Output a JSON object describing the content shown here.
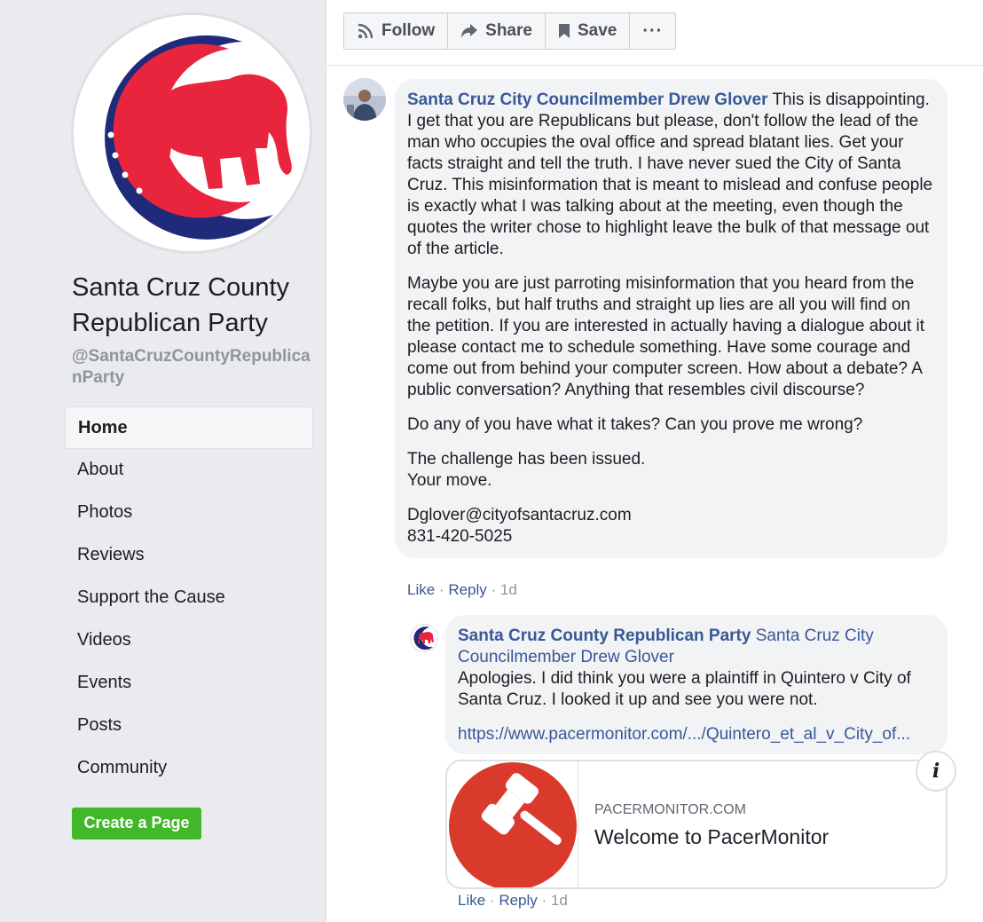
{
  "page": {
    "name": "Santa Cruz County Republican Party",
    "handle": "@SantaCruzCountyRepublicanParty"
  },
  "nav": {
    "items": [
      {
        "label": "Home",
        "active": true
      },
      {
        "label": "About"
      },
      {
        "label": "Photos"
      },
      {
        "label": "Reviews"
      },
      {
        "label": "Support the Cause"
      },
      {
        "label": "Videos"
      },
      {
        "label": "Events"
      },
      {
        "label": "Posts"
      },
      {
        "label": "Community"
      }
    ]
  },
  "create_page_label": "Create a Page",
  "actions": {
    "follow": "Follow",
    "share": "Share",
    "save": "Save",
    "more": "···"
  },
  "comment1": {
    "author": "Santa Cruz City Councilmember Drew Glover",
    "p1": "This is disappointing. I get that you are Republicans but please, don't follow the lead of the man who occupies the oval office and spread blatant lies. Get your facts straight and tell the truth. I have never sued the City of Santa Cruz. This misinformation that is meant to mislead and confuse people is exactly what I was talking about at the meeting, even though the quotes the writer chose to highlight leave the bulk of that message out of the article.",
    "p2": "Maybe you are just parroting misinformation that you heard from the recall folks, but half truths and straight up lies are all you will find on the petition. If you are interested in actually having a dialogue about it please contact me to schedule something. Have some courage and come out from behind your computer screen. How about a debate? A public conversation? Anything that resembles civil discourse?",
    "p3": "Do any of you have what it takes? Can you prove me wrong?",
    "p4a": "The challenge has been issued.",
    "p4b": "Your move.",
    "email": "Dglover@cityofsantacruz.com",
    "phone": "831-420-5025",
    "like": "Like",
    "reply": "Reply",
    "time": "1d"
  },
  "comment2": {
    "author": "Santa Cruz County Republican Party",
    "mention": "Santa Cruz City Councilmember Drew Glover",
    "text": "Apologies. I did think you were a plaintiff in Quintero v City of Santa Cruz. I looked it up and see you were not.",
    "url": "https://www.pacermonitor.com/.../Quintero_et_al_v_City_of...",
    "like": "Like",
    "reply": "Reply",
    "time": "1d"
  },
  "link_card": {
    "domain": "PACERMONITOR.COM",
    "title": "Welcome to PacerMonitor",
    "info_icon": "i"
  },
  "colors": {
    "link_blue": "#385898",
    "elephant_red": "#e8253d",
    "logo_navy": "#1f2a7a",
    "create_green": "#42b72a",
    "gavel_red": "#d93a2b"
  }
}
